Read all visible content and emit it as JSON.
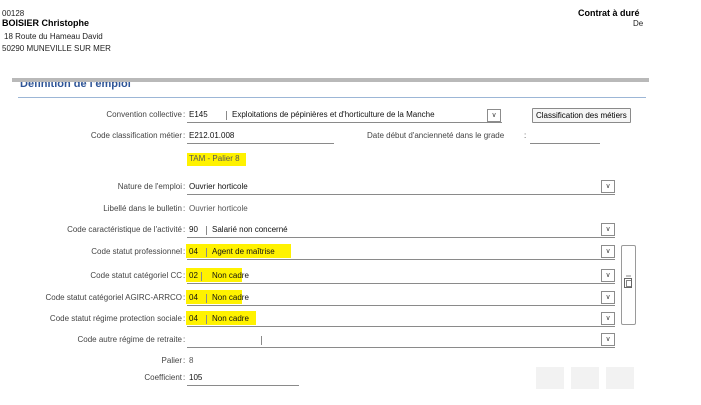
{
  "header": {
    "code": "00128",
    "name": "BOISIER Christophe",
    "address1": "18 Route du Hameau David",
    "address2": "50290 MUNEVILLE SUR MER",
    "contract_title": "Contrat à duré",
    "contract_sub": "De"
  },
  "section": {
    "title": "Définition de l'emploi"
  },
  "colon": ":",
  "form": {
    "convention": {
      "label": "Convention collective",
      "code": "E145",
      "desc": "Exploitations de pépinières et d'horticulture de la Manche",
      "button": "Classification des métiers"
    },
    "classification": {
      "label": "Code classification métier",
      "value": "E212.01.008",
      "sub": "TAM - Palier 8"
    },
    "anciennete": {
      "label": "Date début d'ancienneté dans le grade",
      "value": ""
    },
    "nature": {
      "label": "Nature de l'emploi",
      "value": "Ouvrier horticole"
    },
    "libelle": {
      "label": "Libellé dans le bulletin",
      "value": "Ouvrier horticole"
    },
    "activite": {
      "label": "Code caractéristique de l'activité",
      "code": "90",
      "value": "Salarié non concerné"
    },
    "statut_pro": {
      "label": "Code statut professionnel",
      "code": "04",
      "value": "Agent de maîtrise"
    },
    "statut_cc": {
      "label": "Code statut catégoriel CC",
      "code": "02",
      "value": "Non cadre"
    },
    "statut_agirc": {
      "label": "Code statut catégoriel AGIRC-ARRCO",
      "code": "04",
      "value": "Non cadre"
    },
    "statut_regime": {
      "label": "Code statut régime protection sociale",
      "code": "04",
      "value": "Non cadre"
    },
    "autre_regime": {
      "label": "Code autre régime de retraite",
      "value": ""
    },
    "palier": {
      "label": "Palier",
      "value": "8"
    },
    "coefficient": {
      "label": "Coefficient",
      "value": "105"
    }
  },
  "icons": {
    "dropdown": "chevron-down-icon",
    "side": "copy-icon"
  },
  "colors": {
    "highlight": "#fff200",
    "section": "#2f5597"
  }
}
